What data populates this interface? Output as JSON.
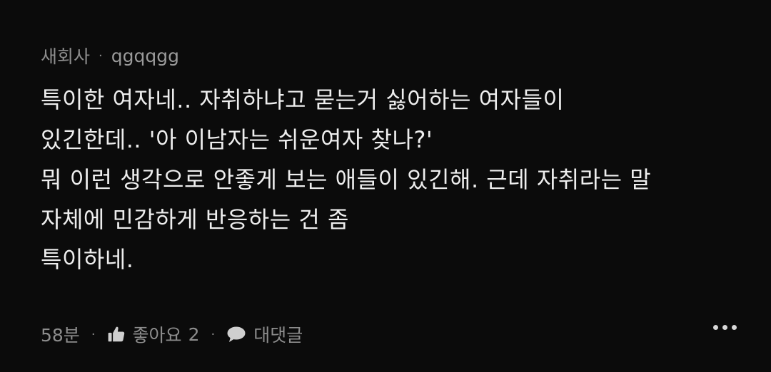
{
  "comment": {
    "author": "새회사",
    "separator": "·",
    "username": "qgqqgg",
    "lines": [
      "특이한 여자네.. 자취하냐고 묻는거 싫어하는 여자들이",
      "있긴한데.. '아 이남자는 쉬운여자 찾나?'",
      "뭐 이런 생각으로 안좋게 보는 애들이 있긴해. 근데 자취라는 말",
      "자체에 민감하게 반응하는 건 좀",
      "특이하네."
    ],
    "time": "58분",
    "like_label": "좋아요",
    "like_count": "2",
    "reply_label": "대댓글",
    "icons": {
      "like": "thumbs-up-icon",
      "reply": "speech-bubble-icon",
      "more": "more-dots-icon"
    }
  }
}
